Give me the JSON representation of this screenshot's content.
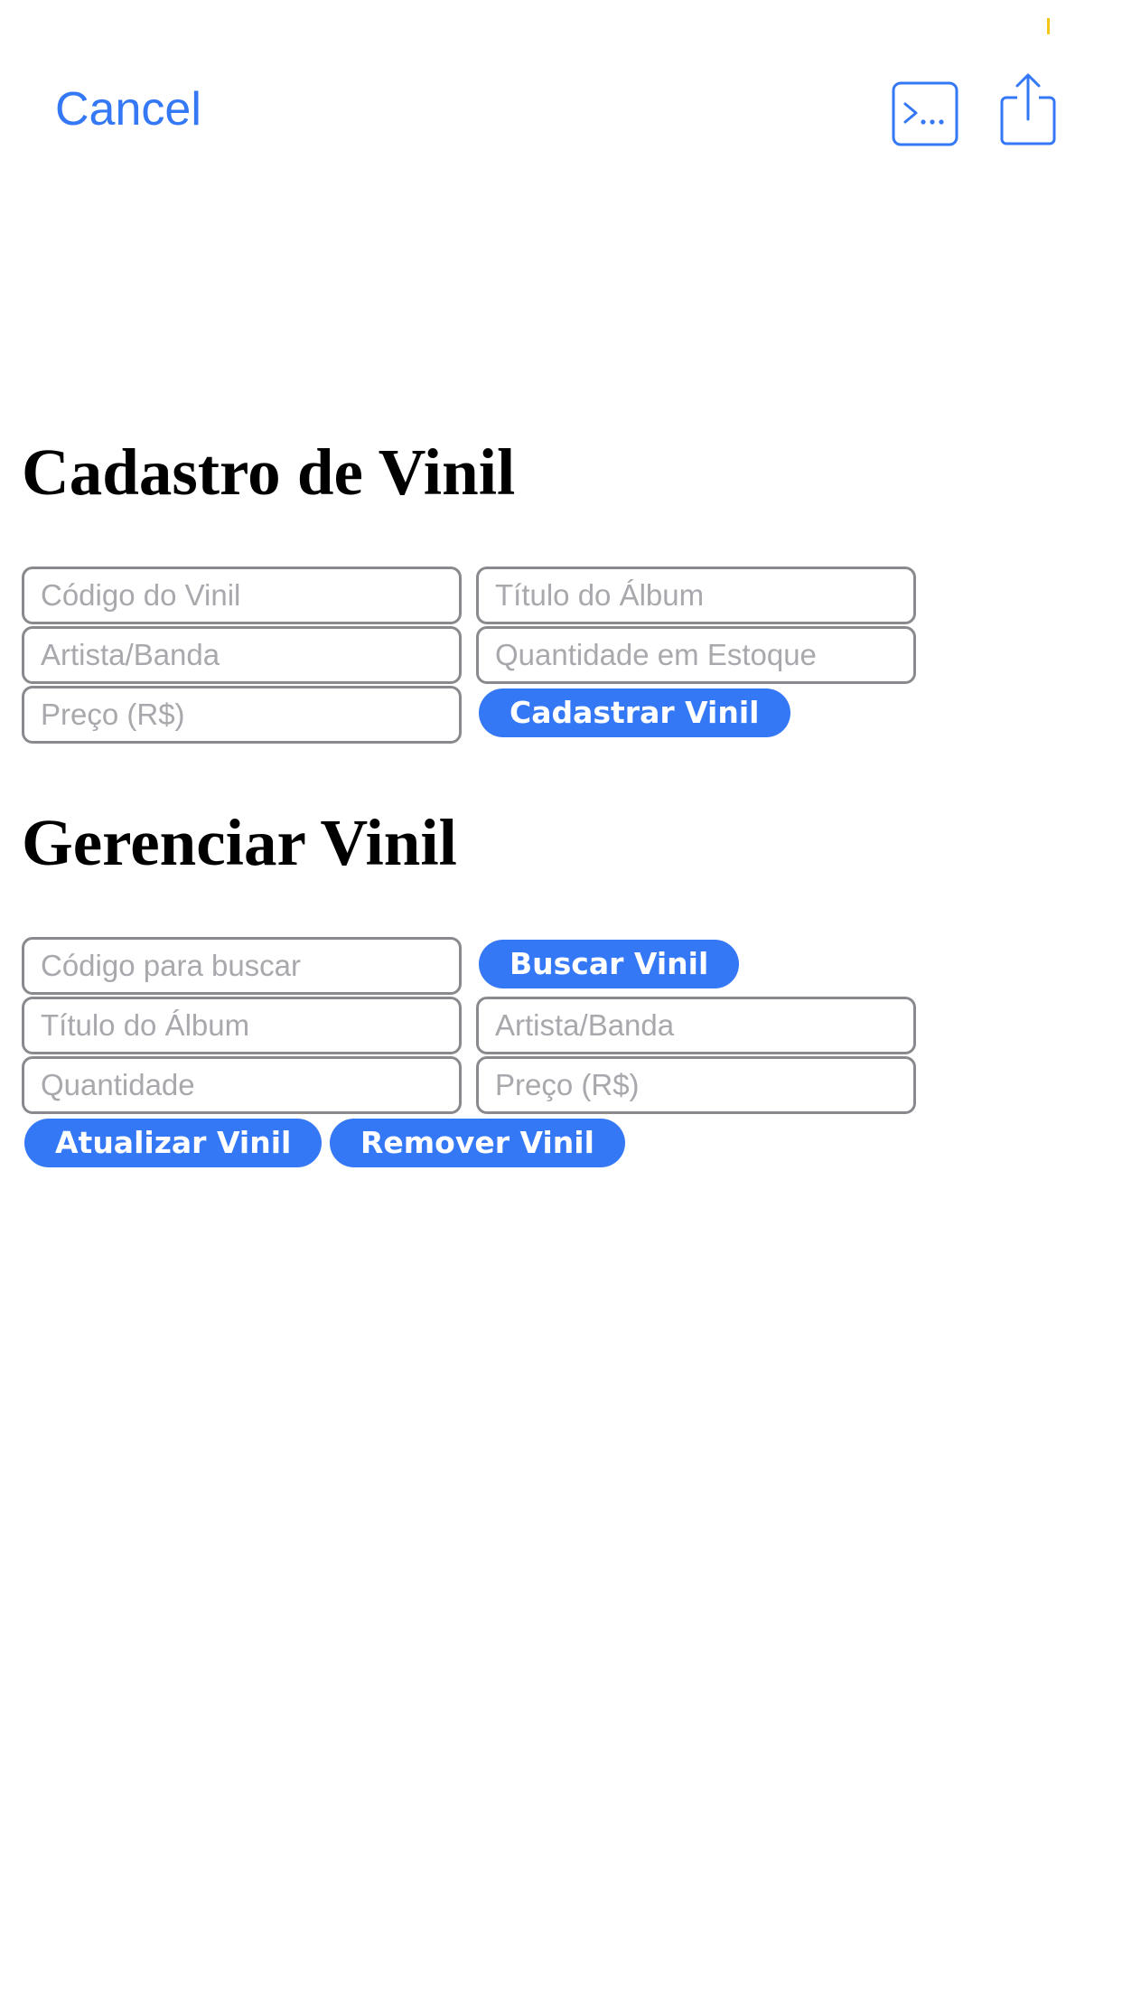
{
  "toolbar": {
    "cancel_label": "Cancel",
    "console_icon": "console-icon",
    "share_icon": "share-icon",
    "accent_color": "#3478f6"
  },
  "register": {
    "title": "Cadastro de Vinil",
    "fields": {
      "codigo_placeholder": "Código do Vinil",
      "titulo_placeholder": "Título do Álbum",
      "artista_placeholder": "Artista/Banda",
      "quantidade_placeholder": "Quantidade em Estoque",
      "preco_placeholder": "Preço (R$)"
    },
    "submit_label": "Cadastrar Vinil"
  },
  "manage": {
    "title": "Gerenciar Vinil",
    "fields": {
      "busca_placeholder": "Código para buscar",
      "titulo_placeholder": "Título do Álbum",
      "artista_placeholder": "Artista/Banda",
      "quantidade_placeholder": "Quantidade",
      "preco_placeholder": "Preço (R$)"
    },
    "search_label": "Buscar Vinil",
    "update_label": "Atualizar Vinil",
    "remove_label": "Remover Vinil"
  }
}
